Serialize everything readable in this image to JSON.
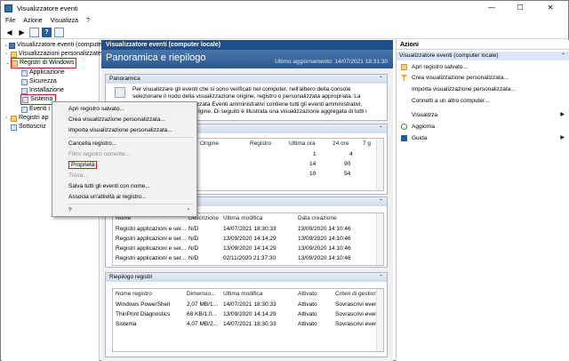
{
  "window": {
    "title": "Visualizzatore eventi",
    "minimize": "—",
    "maximize": "☐",
    "close": "✕"
  },
  "menu": [
    "File",
    "Azione",
    "Visualizza",
    "?"
  ],
  "toolbar": {
    "help_label": "?"
  },
  "tree": {
    "root": "Visualizzatore eventi (computer",
    "custom": "Visualizzazioni personalizzate",
    "windows_logs": "Registri di Windows",
    "application": "Applicazione",
    "security": "Sicurezza",
    "setup": "Installazione",
    "system": "Sistema",
    "forwarded": "Eventi i",
    "apps_services": "Registri ap",
    "subscriptions": "Sottoscriz"
  },
  "center": {
    "header": "Visualizzatore eventi (computer locale)",
    "banner_title": "Panoramica e riepilogo",
    "last_update": "Ultimo aggiornamento: 14/07/2021 18:31:30",
    "overview": {
      "title": "Panoramica",
      "text": "Per visualizzare gli eventi che si sono verificati nel computer, nell'albero della console selezionare il nodo della visualizzazione origine, registro o personalizzata appropriata. La visualizzazione personalizzata Eventi amministrativi contiene tutti gli eventi amministrativi, indipendentemente dall'origine. Di seguito è illustrata una visualizzazione aggregata di tutti i"
    },
    "summary": {
      "headers": [
        "Origine",
        "Registro",
        "Ultima ora",
        "24 ore",
        "7 g"
      ],
      "rows": [
        [
          "",
          "",
          "",
          "1",
          "4"
        ],
        [
          "",
          "",
          "14",
          "90",
          ""
        ],
        [
          "",
          "",
          "10",
          "54",
          ""
        ]
      ]
    },
    "recent": {
      "headers": [
        "Nome",
        "Descrizione",
        "Ultima modifica",
        "Data creazione"
      ],
      "rows": [
        [
          "Registri applicazioni e ser...",
          "N/D",
          "14/07/2021 18:30:33",
          "13/09/2020 14:10:46"
        ],
        [
          "Registri applicazioni e ser...",
          "N/D",
          "13/09/2020 14:14:29",
          "13/09/2020 14:10:46"
        ],
        [
          "Registri applicazioni e ser...",
          "N/D",
          "13/09/2020 14:14:29",
          "13/09/2020 14:10:46"
        ],
        [
          "Registri applicazioni e ser...",
          "N/D",
          "02/11/2020 21:37:30",
          "13/09/2020 14:10:46"
        ]
      ]
    },
    "logsummary": {
      "title": "Riepilogo registri",
      "headers": [
        "Nome registro",
        "Dimensio...",
        "Ultima modifica",
        "Attivato",
        "Criteri di gestion"
      ],
      "rows": [
        [
          "Windows PowerShell",
          "2,07 MB/1...",
          "14/07/2021 18:30:33",
          "Attivato",
          "Sovrascrivi even"
        ],
        [
          "ThinPrint Diagnostics",
          "68 KB/1,0...",
          "13/09/2020 14:14:29",
          "Attivato",
          "Sovrascrivi even"
        ],
        [
          "Sistema",
          "4,07 MB/2...",
          "14/07/2021 18:30:33",
          "Attivato",
          "Sovrascrivi even"
        ]
      ]
    }
  },
  "context_menu": {
    "items": [
      "Apri registro salvato...",
      "Crea visualizzazione personalizzata...",
      "Importa visualizzazione personalizzata...",
      "Cancella registro...",
      "Filtro registro corrente...",
      "Proprietà",
      "Trova...",
      "Salva tutti gli eventi con nome...",
      "Associa un'attività al registro...",
      "?"
    ]
  },
  "actions": {
    "title": "Azioni",
    "section": "Visualizzatore eventi (computer locale)",
    "items": [
      "Apri registro salvato...",
      "Crea visualizzazione personalizzata...",
      "Importa visualizzazione personalizzata...",
      "Connetti a un altro computer...",
      "Visualizza",
      "Aggiorna",
      "Guida"
    ]
  },
  "colors": {
    "accent": "#1e4f8a",
    "highlight": "#e01020"
  }
}
